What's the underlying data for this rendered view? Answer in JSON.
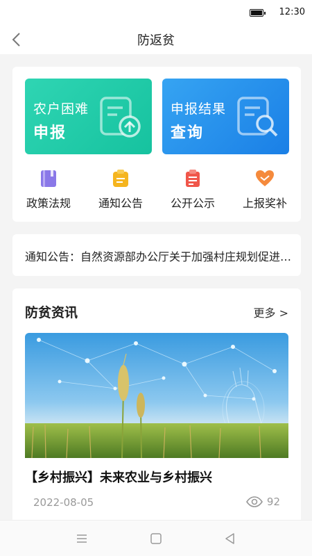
{
  "status_bar": {
    "time": "12:30",
    "battery_icon": "battery-icon"
  },
  "nav": {
    "title": "防返贫",
    "back_icon": "chevron-left-icon"
  },
  "primary_actions": [
    {
      "line1": "农户困难",
      "line2": "申报",
      "icon": "document-upload-icon",
      "color": "#1fcaa8"
    },
    {
      "line1": "申报结果",
      "line2": "查询",
      "icon": "document-search-icon",
      "color": "#2a8ff0"
    }
  ],
  "quick_links": [
    {
      "label": "政策法规",
      "icon": "book-icon",
      "color": "#8a78e8"
    },
    {
      "label": "通知公告",
      "icon": "clipboard-icon",
      "color": "#f5b51f"
    },
    {
      "label": "公开公示",
      "icon": "clipboard-list-icon",
      "color": "#f0564a"
    },
    {
      "label": "上报奖补",
      "icon": "handshake-heart-icon",
      "color": "#f58a3c"
    }
  ],
  "notice": {
    "text": "通知公告：自然资源部办公厅关于加强村庄规划促进乡村振兴的通知"
  },
  "news": {
    "section_title": "防贫资讯",
    "more_label": "更多 >",
    "items": [
      {
        "title": "【乡村振兴】未来农业与乡村振兴",
        "date": "2022-08-05",
        "views": "92",
        "image": "wheat-field-tech-image"
      }
    ]
  },
  "system_nav": {
    "menu_icon": "menu-icon",
    "home_icon": "home-square-icon",
    "back_icon": "back-triangle-icon"
  }
}
